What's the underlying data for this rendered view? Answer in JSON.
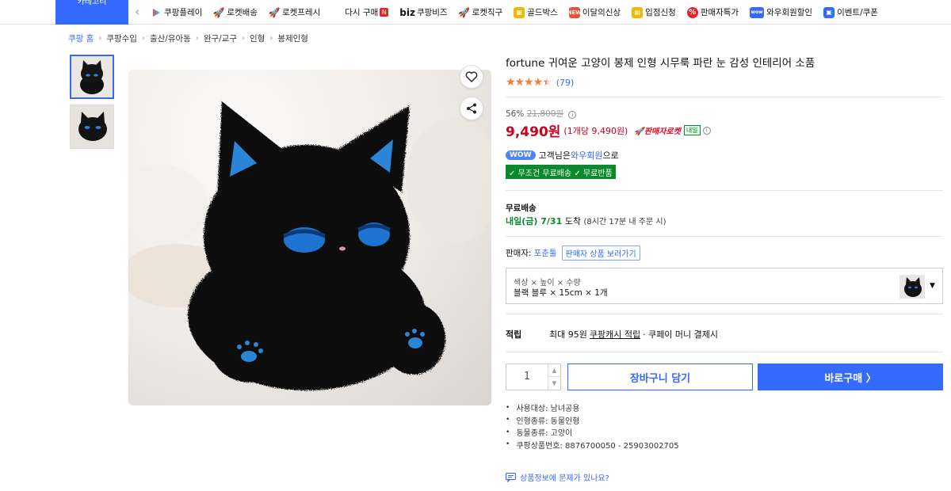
{
  "topbar": {
    "category_label": "카테고리",
    "nav": [
      {
        "label": "쿠팡플레이",
        "icon": "play-icon",
        "color": "#2ca8ff"
      },
      {
        "label": "로켓배송",
        "icon": "rocket-icon",
        "color": "#346aff"
      },
      {
        "label": "로켓프레시",
        "icon": "rocket-fresh-icon",
        "color": "#2ea44f"
      },
      {
        "label": "다시 구매",
        "icon": "repurchase-icon",
        "color": "#f29a2e",
        "badge": "N"
      },
      {
        "label": "쿠팡비즈",
        "icon": "biz-icon",
        "prefix": "biz"
      },
      {
        "label": "로켓직구",
        "icon": "rocket-global-icon",
        "color": "#8e44ff"
      },
      {
        "label": "골드박스",
        "icon": "goldbox-icon",
        "color": "#f2b705"
      },
      {
        "label": "이달의신상",
        "icon": "new-item-icon",
        "color": "#e5533a"
      },
      {
        "label": "입점신청",
        "icon": "store-icon",
        "color": "#f2b705"
      },
      {
        "label": "판매자특가",
        "icon": "percent-icon",
        "color": "#e52528"
      },
      {
        "label": "와우회원할인",
        "icon": "wow-icon",
        "color": "#346aff"
      },
      {
        "label": "이벤트/쿠폰",
        "icon": "coupon-icon",
        "color": "#346aff"
      }
    ]
  },
  "breadcrumb": [
    "쿠팡 홈",
    "쿠팡수입",
    "출산/유아동",
    "완구/교구",
    "인형",
    "봉제인형"
  ],
  "product": {
    "title": "fortune 귀여운 고양이 봉제 인형 시무룩 파란 눈 감성 인테리어 소품",
    "rating": 4.5,
    "review_count": "(79)",
    "discount_rate": "56%",
    "original_price": "21,800원",
    "price": "9,490원",
    "unit_price": "(1개당 9,490원)",
    "rocket_label": "판매자로켓",
    "tomorrow_tag": "내일",
    "wow_badge": "WOW",
    "wow_text_1": "고객님은",
    "wow_member": "와우회원",
    "wow_text_2": "으로",
    "free_badge": "✓ 무조건 무료배송 ✓ 무료반품",
    "shipping_label": "무료배송",
    "arrival_main": "내일(금) 7/31",
    "arrival_suffix": "도착",
    "arrival_note": "(8시간 17분 내 주문 시)",
    "seller_label": "판매자:",
    "seller_name": "포춘툴",
    "seller_more": "판매자 상품 보러가기",
    "option_header": "색상 × 높이 × 수량",
    "option_value": "블랙 블루 × 15cm × 1개",
    "point_label": "적립",
    "point_text_1": "최대 95원",
    "point_link": "쿠팡캐시 적립",
    "point_text_2": "· 쿠페이 머니 결제시",
    "quantity": "1",
    "cart_button": "장바구니 담기",
    "buy_button": "바로구매 〉",
    "attributes": [
      "사용대상: 남녀공용",
      "인형종류: 동물인형",
      "동물종류: 고양이",
      "쿠팡상품번호: 8876700050 - 25903002705"
    ],
    "report_link": "상품정보에 문제가 있나요?"
  },
  "colors": {
    "accent": "#346aff",
    "price": "#c8001d",
    "green": "#0a8a2c",
    "star": "#f57c3b"
  }
}
